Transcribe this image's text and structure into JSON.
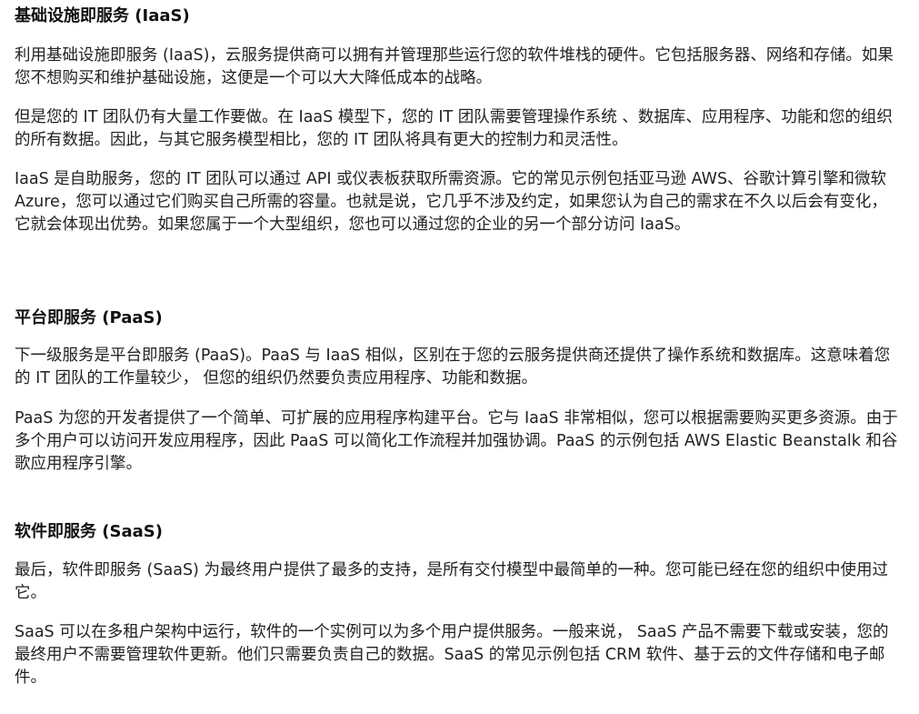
{
  "sections": [
    {
      "title": "基础设施即服务 (IaaS)",
      "paragraphs": [
        "利用基础设施即服务 (IaaS)，云服务提供商可以拥有并管理那些运行您的软件堆栈的硬件。它包括服务器、网络和存储。如果您不想购买和维护基础设施，这便是一个可以大大降低成本的战略。",
        "但是您的 IT 团队仍有大量工作要做。在 IaaS 模型下，您的 IT 团队需要管理操作系统 、数据库、应用程序、功能和您的组织的所有数据。因此，与其它服务模型相比，您的 IT 团队将具有更大的控制力和灵活性。",
        "IaaS 是自助服务，您的 IT 团队可以通过 API 或仪表板获取所需资源。它的常见示例包括亚马逊 AWS、谷歌计算引擎和微软 Azure，您可以通过它们购买自己所需的容量。也就是说，它几乎不涉及约定，如果您认为自己的需求在不久以后会有变化，它就会体现出优势。如果您属于一个大型组织，您也可以通过您的企业的另一个部分访问 IaaS。"
      ]
    },
    {
      "title": "平台即服务 (PaaS)",
      "paragraphs": [
        "下一级服务是平台即服务 (PaaS)。PaaS 与 IaaS 相似，区别在于您的云服务提供商还提供了操作系统和数据库。这意味着您的 IT 团队的工作量较少， 但您的组织仍然要负责应用程序、功能和数据。",
        "PaaS 为您的开发者提供了一个简单、可扩展的应用程序构建平台。它与 IaaS 非常相似，您可以根据需要购买更多资源。由于多个用户可以访问开发应用程序，因此 PaaS 可以简化工作流程并加强协调。PaaS 的示例包括 AWS Elastic Beanstalk 和谷歌应用程序引擎。"
      ]
    },
    {
      "title": "软件即服务 (SaaS)",
      "paragraphs": [
        "最后，软件即服务 (SaaS) 为最终用户提供了最多的支持，是所有交付模型中最简单的一种。您可能已经在您的组织中使用过它。",
        "SaaS 可以在多租户架构中运行，软件的一个实例可以为多个用户提供服务。一般来说， SaaS 产品不需要下载或安装，您的最终用户不需要管理软件更新。他们只需要负责自己的数据。SaaS 的常见示例包括 CRM 软件、基于云的文件存储和电子邮件。"
      ]
    }
  ]
}
